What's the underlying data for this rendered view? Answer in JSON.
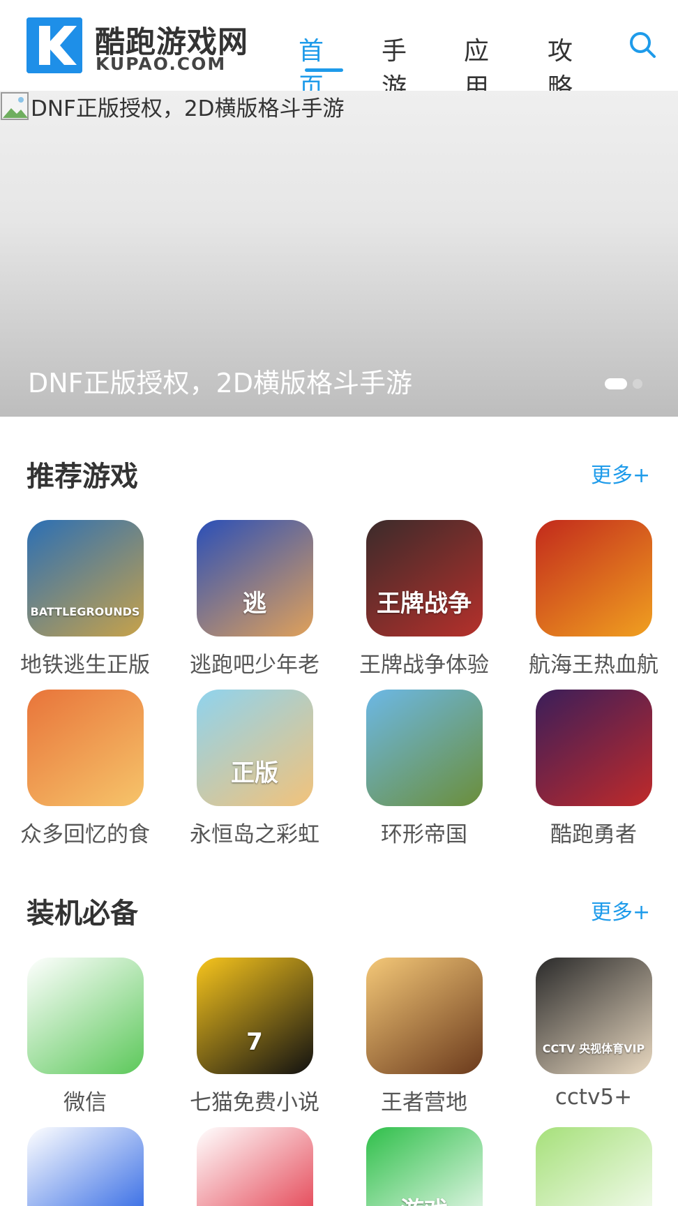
{
  "header": {
    "logo_title": "酷跑游戏网",
    "logo_subtitle": "KUPAO.COM",
    "nav": [
      "首页",
      "手游",
      "应用",
      "攻略"
    ],
    "active_nav": "首页",
    "search_icon": "search-icon"
  },
  "banner": {
    "alt_text": "DNF正版授权，2D横版格斗手游",
    "caption": "DNF正版授权，2D横版格斗手游",
    "slide_count": 2,
    "active_slide": 1
  },
  "recommended": {
    "title": "推荐游戏",
    "more": "更多+",
    "apps": [
      {
        "name": "地铁逃生正版",
        "icon_text": "BATTLEGROUNDS",
        "color_a": "#2b6fb5",
        "color_b": "#c7a24a"
      },
      {
        "name": "逃跑吧少年老",
        "icon_text": "逃",
        "color_a": "#2a4fb8",
        "color_b": "#e0a15a"
      },
      {
        "name": "王牌战争体验",
        "icon_text": "王牌战争",
        "color_a": "#3b2b2b",
        "color_b": "#b5302b"
      },
      {
        "name": "航海王热血航",
        "icon_text": "",
        "color_a": "#c22a1c",
        "color_b": "#f0a020"
      },
      {
        "name": "众多回忆的食",
        "icon_text": "",
        "color_a": "#e8743a",
        "color_b": "#f6c46a"
      },
      {
        "name": "永恒岛之彩虹",
        "icon_text": "正版",
        "color_a": "#8fd3ee",
        "color_b": "#f2c27a"
      },
      {
        "name": "环形帝国",
        "icon_text": "",
        "color_a": "#6cb8e6",
        "color_b": "#6b8e3a"
      },
      {
        "name": "酷跑勇者",
        "icon_text": "",
        "color_a": "#3a1e5a",
        "color_b": "#c02a2a"
      }
    ]
  },
  "essentials": {
    "title": "装机必备",
    "more": "更多+",
    "apps": [
      {
        "name": "微信",
        "icon_text": "",
        "color_a": "#ffffff",
        "color_b": "#5cc85a"
      },
      {
        "name": "七猫免费小说",
        "icon_text": "7",
        "color_a": "#f7c51d",
        "color_b": "#111111"
      },
      {
        "name": "王者营地",
        "icon_text": "",
        "color_a": "#f4c878",
        "color_b": "#6b3a1c"
      },
      {
        "name": "cctv5+",
        "icon_text": "CCTV 央视体育VIP",
        "color_a": "#2a2a2a",
        "color_b": "#e8d8c0"
      },
      {
        "name": "",
        "icon_text": "",
        "color_a": "#ffffff",
        "color_b": "#1453e0"
      },
      {
        "name": "",
        "icon_text": "",
        "color_a": "#ffffff",
        "color_b": "#e0283a"
      },
      {
        "name": "",
        "icon_text": "游戏",
        "color_a": "#2fbf4a",
        "color_b": "#ffffff"
      },
      {
        "name": "",
        "icon_text": "",
        "color_a": "#a6e07a",
        "color_b": "#ffffff"
      }
    ]
  }
}
